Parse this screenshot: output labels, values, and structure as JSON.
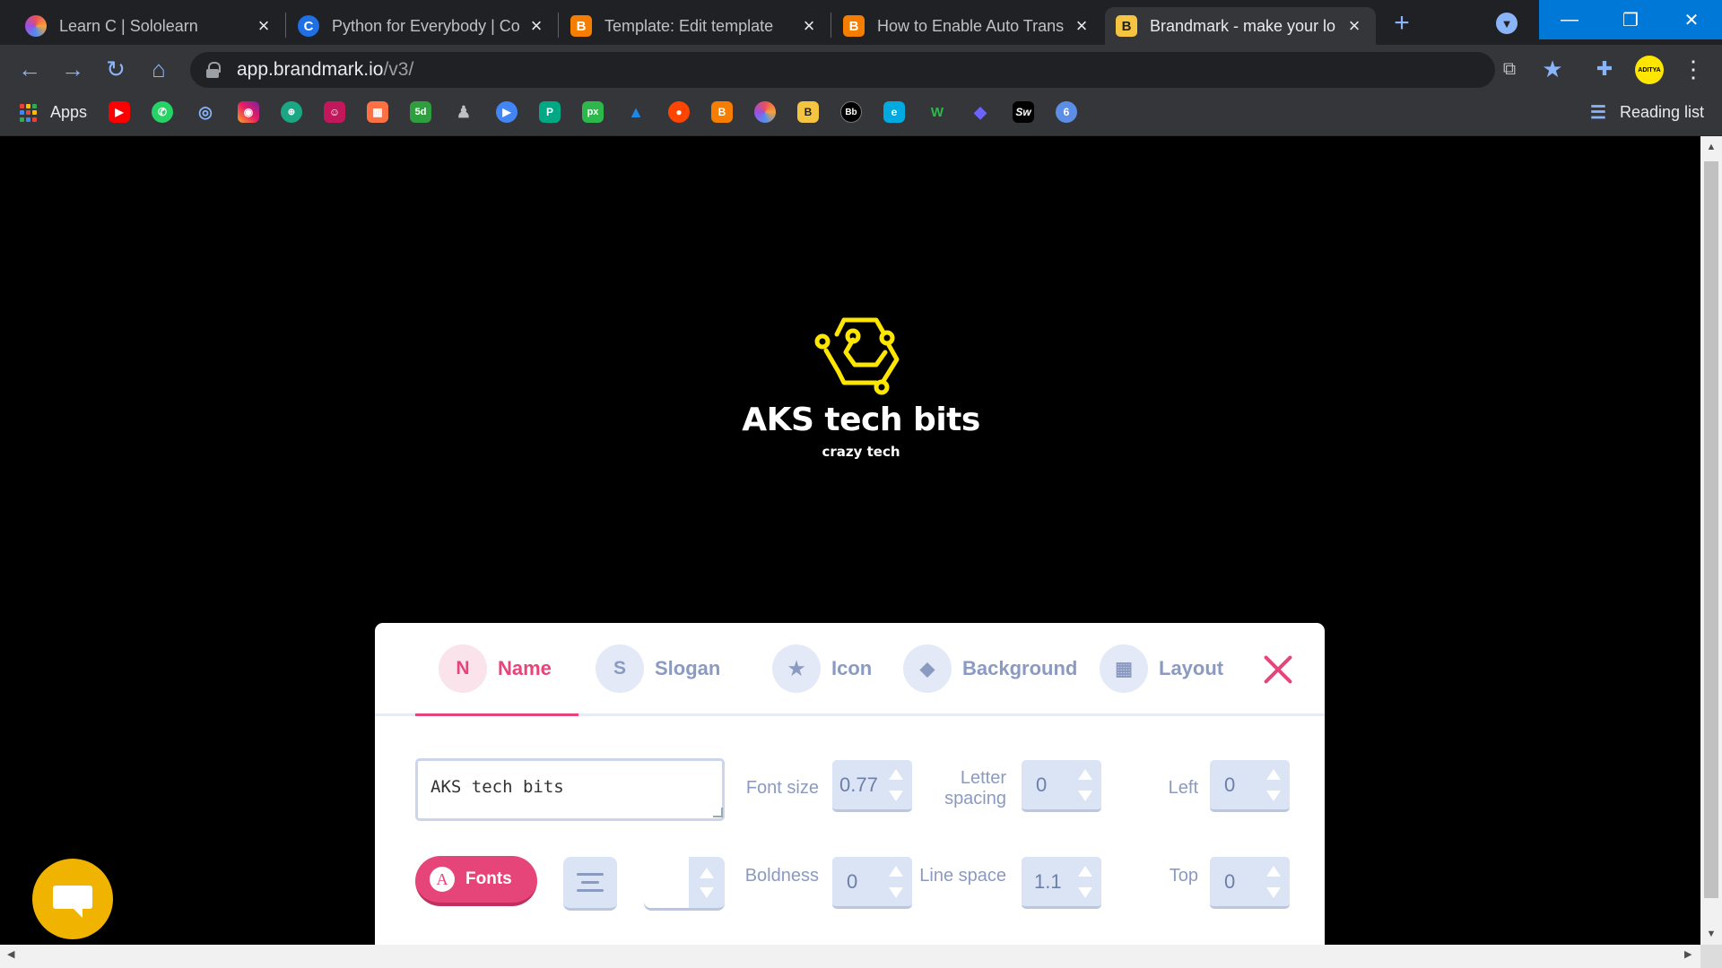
{
  "tabs": [
    {
      "title": "Learn C | Sololearn",
      "active": false
    },
    {
      "title": "Python for Everybody | Co",
      "active": false
    },
    {
      "title": "Template: Edit template",
      "active": false
    },
    {
      "title": "How to Enable Auto Trans",
      "active": false
    },
    {
      "title": "Brandmark - make your lo",
      "active": true
    }
  ],
  "omnibox": {
    "host": "app.brandmark.io",
    "path": "/v3/"
  },
  "avatar_text": "ADITYA",
  "bookmarks": {
    "apps_label": "Apps",
    "reading_list_label": "Reading list"
  },
  "logo": {
    "name": "AKS tech bits",
    "slogan": "crazy tech",
    "accent": "#ffe600"
  },
  "editor": {
    "tabs": [
      {
        "letter": "N",
        "label": "Name"
      },
      {
        "letter": "S",
        "label": "Slogan"
      },
      {
        "letter": "",
        "label": "Icon"
      },
      {
        "letter": "",
        "label": "Background"
      },
      {
        "letter": "",
        "label": "Layout"
      }
    ],
    "name_value": "AKS tech bits",
    "fields": {
      "font_size": {
        "label": "Font size",
        "value": "0.77"
      },
      "letter_spacing": {
        "label_1": "Letter",
        "label_2": "spacing",
        "value": "0"
      },
      "left": {
        "label": "Left",
        "value": "0"
      },
      "boldness": {
        "label": "Boldness",
        "value": "0"
      },
      "line_space": {
        "label": "Line space",
        "value": "1.1"
      },
      "top": {
        "label": "Top",
        "value": "0"
      }
    },
    "fonts_button": {
      "icon_letter": "A",
      "label": "Fonts"
    }
  },
  "colors": {
    "accent_pink": "#e6457a",
    "muted_blue": "#8b9ac0",
    "brand_yellow": "#ffe600",
    "chat_yellow": "#f0b400"
  }
}
